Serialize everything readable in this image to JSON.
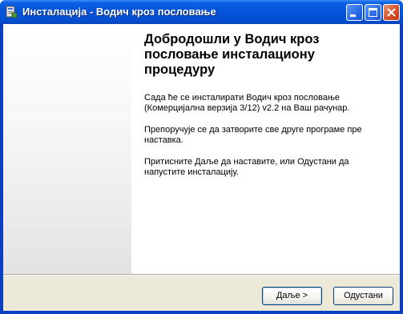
{
  "window": {
    "title": "Инсталација - Водич кроз пословање"
  },
  "titlebar_buttons": [
    "minimize-icon",
    "maximize-icon",
    "close-icon"
  ],
  "content": {
    "heading": "Добродошли у Водич кроз пословање инсталациону процедуру",
    "paragraph1": "Сада ће се инсталирати Водич кроз пословање (Комерцијална верзија 3/12) v2.2 на Ваш рачунар.",
    "paragraph2": "Препоручује се да затворите све друге програме пре наставка.",
    "paragraph3": "Притисните Даље да наставите, или Одустани да напустите инсталацију."
  },
  "buttons": {
    "next_label": "Даље >",
    "cancel_label": "Одустани"
  },
  "colors": {
    "titlebar": "#0553db",
    "close_button": "#d6512b",
    "button_panel": "#ece9d8"
  }
}
